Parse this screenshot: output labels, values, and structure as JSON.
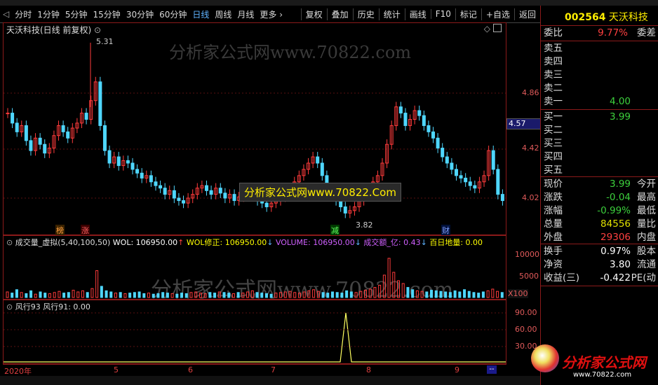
{
  "toolbar": {
    "periods": [
      "分时",
      "1分钟",
      "5分钟",
      "15分钟",
      "30分钟",
      "60分钟",
      "日线",
      "周线",
      "月线",
      "更多"
    ],
    "active_period": "日线",
    "right_items": [
      "复权",
      "叠加",
      "历史",
      "统计",
      "画线",
      "F10",
      "标记",
      "+自选",
      "返回"
    ]
  },
  "main_chart": {
    "title": "天沃科技(日线 前复权)",
    "y_ticks": [
      "4.86",
      "4.42",
      "4.02"
    ],
    "current_price_tag": "4.57",
    "high_label": "5.31",
    "low_label": "3.82",
    "tags": [
      "榜",
      "涨",
      "减",
      "财"
    ],
    "watermark": "分析家公式网www.70822.com",
    "promo_text": "分析家公式网www.70822.Com"
  },
  "volume_pane": {
    "title": "成交量_虚拟(5,40,100,50)",
    "wol": "WOL: 106950.00",
    "wol_fix": "WOL修正: 106950.00",
    "volume": "VOLUME: 106950.00",
    "amount": "成交额_亿: 0.43",
    "baiyi": "百日地量: 0.00",
    "y_ticks": [
      "10000",
      "5000"
    ],
    "unit": "X100",
    "watermark": "分析家公式网www.70822.com"
  },
  "indicator_pane": {
    "title": "风行93 风行91: 0.00",
    "y_ticks": [
      "90.00",
      "60.00",
      "30.00"
    ]
  },
  "x_axis": [
    "2020年",
    "5",
    "6",
    "7",
    "8",
    "9"
  ],
  "quote": {
    "code": "002564",
    "name": "天沃科技",
    "weibi_label": "委比",
    "weibi": "9.77%",
    "weicha_label": "委差",
    "asks": [
      {
        "label": "卖五",
        "price": ""
      },
      {
        "label": "卖四",
        "price": ""
      },
      {
        "label": "卖三",
        "price": ""
      },
      {
        "label": "卖二",
        "price": ""
      },
      {
        "label": "卖一",
        "price": "4.00"
      }
    ],
    "bids": [
      {
        "label": "买一",
        "price": "3.99"
      },
      {
        "label": "买二",
        "price": ""
      },
      {
        "label": "买三",
        "price": ""
      },
      {
        "label": "买四",
        "price": ""
      },
      {
        "label": "买五",
        "price": ""
      }
    ],
    "stats": [
      {
        "k": "现价",
        "v": "3.99",
        "c": "green",
        "k2": "今开"
      },
      {
        "k": "涨跌",
        "v": "-0.04",
        "c": "green",
        "k2": "最高"
      },
      {
        "k": "涨幅",
        "v": "-0.99%",
        "c": "green",
        "k2": "最低"
      },
      {
        "k": "总量",
        "v": "84556",
        "c": "yel",
        "k2": "量比"
      },
      {
        "k": "外盘",
        "v": "29306",
        "c": "red",
        "k2": "内盘"
      }
    ],
    "stats2": [
      {
        "k": "换手",
        "v": "0.97%",
        "c": "white",
        "k2": "股本"
      },
      {
        "k": "净资",
        "v": "3.80",
        "c": "white",
        "k2": "流通"
      },
      {
        "k": "收益(三)",
        "v": "-0.422",
        "c": "white",
        "k2": "PE(动"
      }
    ],
    "logo_text": "分析家公式网",
    "logo_url": "www.70822.com"
  },
  "colors": {
    "up": "#ff3b3b",
    "down": "#4fd7ff",
    "frame": "#8b1a1a"
  }
}
